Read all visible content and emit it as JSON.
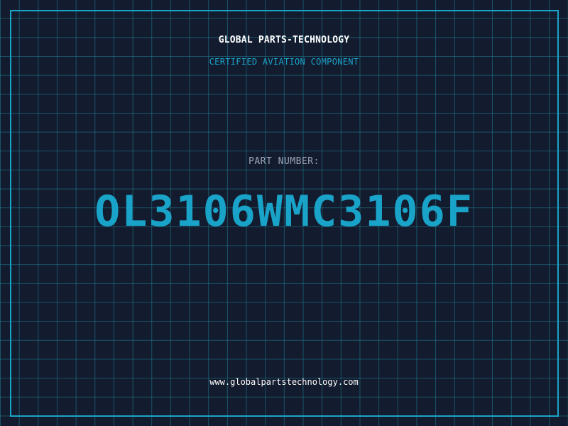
{
  "header": {
    "company": "GLOBAL PARTS-TECHNOLOGY",
    "subtitle": "CERTIFIED AVIATION COMPONENT"
  },
  "part": {
    "label": "PART NUMBER:",
    "number": "OL3106WMC3106F"
  },
  "footer": {
    "website": "www.globalpartstechnology.com"
  },
  "colors": {
    "background": "#131b2e",
    "grid": "#1f8296",
    "accent": "#1aa3c8",
    "label": "#9aa6b8",
    "text": "#ffffff"
  }
}
